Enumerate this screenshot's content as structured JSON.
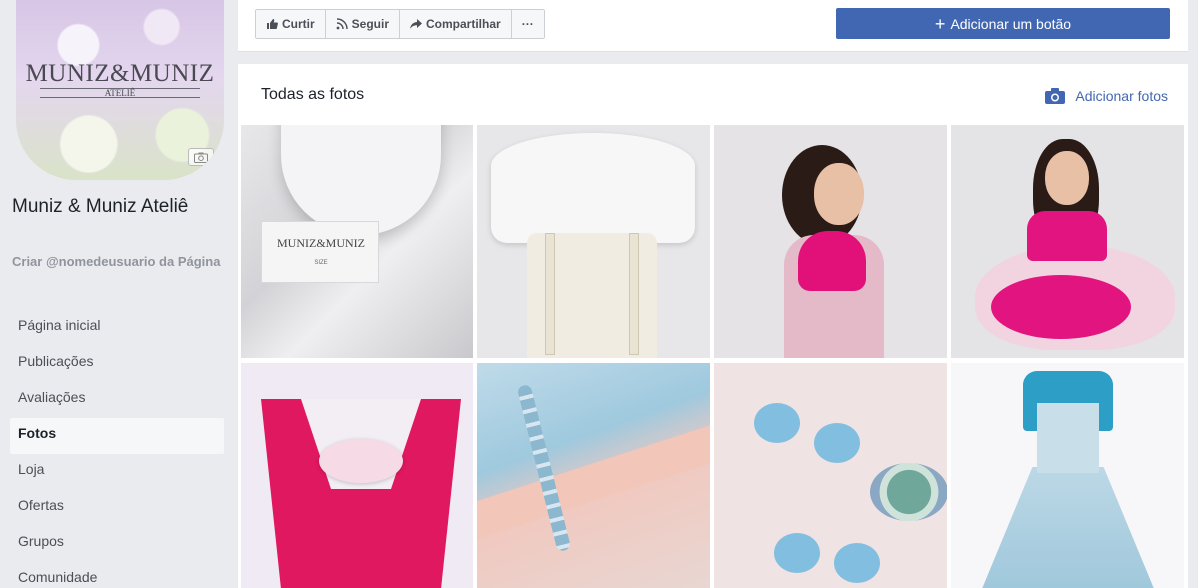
{
  "profile": {
    "logo_text": "MUNIZ&MUNIZ",
    "logo_sub": "ATELIÊ",
    "page_name": "Muniz & Muniz Ateliê",
    "username_prompt": "Criar @nomedeusuario da Página"
  },
  "nav": {
    "items": [
      {
        "label": "Página inicial",
        "active": false
      },
      {
        "label": "Publicações",
        "active": false
      },
      {
        "label": "Avaliações",
        "active": false
      },
      {
        "label": "Fotos",
        "active": true
      },
      {
        "label": "Loja",
        "active": false
      },
      {
        "label": "Ofertas",
        "active": false
      },
      {
        "label": "Grupos",
        "active": false
      },
      {
        "label": "Comunidade",
        "active": false
      }
    ]
  },
  "actions": {
    "like": "Curtir",
    "follow": "Seguir",
    "share": "Compartilhar",
    "more": "···",
    "add_button": "Adicionar um botão",
    "add_button_icon": "+"
  },
  "photos": {
    "title": "Todas as fotos",
    "add_label": "Adicionar fotos",
    "label_brand": "MUNIZ&MUNIZ",
    "label_sub": "ATELIÊ",
    "label_size": "SIZE"
  },
  "colors": {
    "brand_blue": "#4267b2",
    "background": "#e9ebee"
  }
}
